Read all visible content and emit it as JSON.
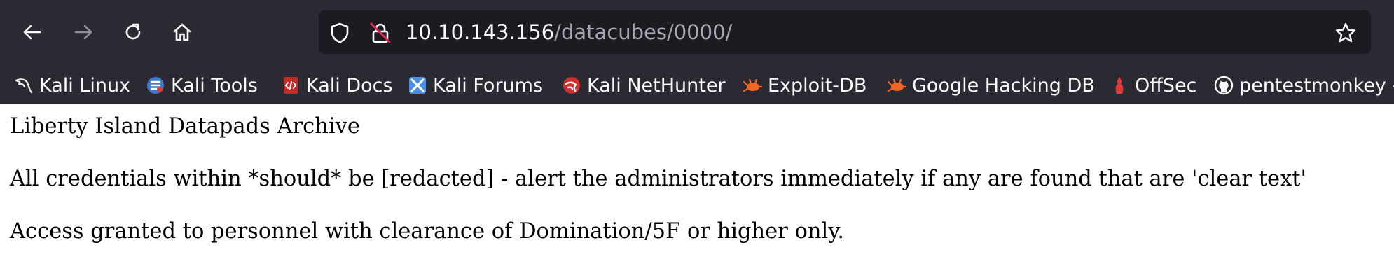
{
  "browser": {
    "url": {
      "host": "10.10.143.156",
      "path": "/datacubes/0000/"
    },
    "nav": {
      "back_icon": "back-arrow-icon",
      "forward_icon": "forward-arrow-icon",
      "reload_icon": "reload-icon",
      "home_icon": "home-icon",
      "shield_icon": "tracking-protection-shield-icon",
      "lock_icon": "insecure-lock-icon",
      "bookmark_star_icon": "star-icon"
    },
    "bookmarks": [
      {
        "label": "Kali Linux",
        "icon": "kali-dragon-icon"
      },
      {
        "label": "Kali Tools",
        "icon": "kali-tools-icon"
      },
      {
        "label": "Kali Docs",
        "icon": "kali-docs-icon"
      },
      {
        "label": "Kali Forums",
        "icon": "kali-forums-icon"
      },
      {
        "label": "Kali NetHunter",
        "icon": "kali-nethunter-icon"
      },
      {
        "label": "Exploit-DB",
        "icon": "exploit-db-icon"
      },
      {
        "label": "Google Hacking DB",
        "icon": "ghdb-icon"
      },
      {
        "label": "OffSec",
        "icon": "offsec-icon"
      },
      {
        "label": "pentestmonkey -",
        "icon": "github-icon"
      }
    ]
  },
  "page": {
    "heading": "Liberty Island Datapads Archive",
    "line1": "All credentials within *should* be [redacted] - alert the administrators immediately if any are found that are 'clear text'",
    "line2": "Access granted to personnel with clearance of Domination/5F or higher only."
  },
  "colors": {
    "chrome_bg": "#2b2a33",
    "urlbar_bg": "#1c1b22",
    "url_host": "#fbfbfe",
    "url_path": "#a8a7af",
    "page_bg": "#ffffff"
  }
}
